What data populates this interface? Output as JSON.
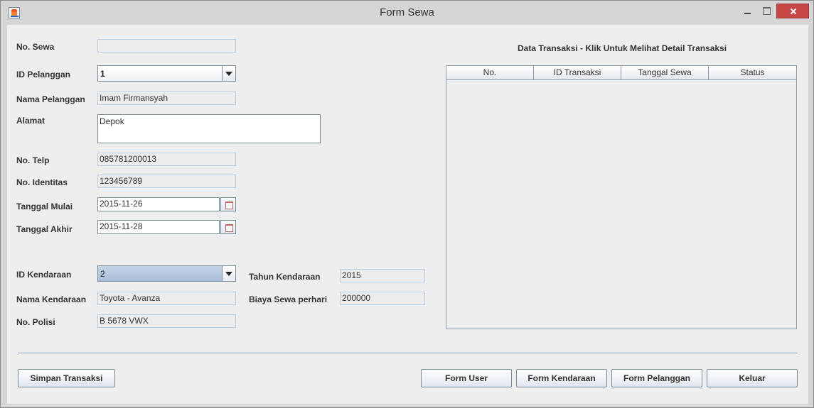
{
  "window": {
    "title": "Form Sewa"
  },
  "form": {
    "no_sewa": {
      "label": "No. Sewa",
      "value": ""
    },
    "id_pelanggan": {
      "label": "ID Pelanggan",
      "value": "1"
    },
    "nama_pelanggan": {
      "label": "Nama Pelanggan",
      "value": "Imam Firmansyah"
    },
    "alamat": {
      "label": "Alamat",
      "value": "Depok"
    },
    "no_telp": {
      "label": "No. Telp",
      "value": "085781200013"
    },
    "no_identitas": {
      "label": "No. Identitas",
      "value": "123456789"
    },
    "tanggal_mulai": {
      "label": "Tanggal Mulai",
      "value": "2015-11-26"
    },
    "tanggal_akhir": {
      "label": "Tanggal Akhir",
      "value": "2015-11-28"
    },
    "id_kendaraan": {
      "label": "ID Kendaraan",
      "value": "2"
    },
    "nama_kendaraan": {
      "label": "Nama Kendaraan",
      "value": "Toyota - Avanza"
    },
    "no_polisi": {
      "label": "No. Polisi",
      "value": "B 5678 VWX"
    },
    "tahun_kendaraan": {
      "label": "Tahun Kendaraan",
      "value": "2015"
    },
    "biaya_sewa": {
      "label": "Biaya Sewa perhari",
      "value": "200000"
    }
  },
  "transactions": {
    "title": "Data Transaksi - Klik Untuk Melihat Detail Transaksi",
    "columns": [
      "No.",
      "ID Transaksi",
      "Tanggal Sewa",
      "Status"
    ],
    "rows": []
  },
  "buttons": {
    "simpan": "Simpan Transaksi",
    "form_user": "Form User",
    "form_kendaraan": "Form Kendaraan",
    "form_pelanggan": "Form Pelanggan",
    "keluar": "Keluar"
  },
  "icons": {
    "app": "java-cup-icon",
    "calendar": "calendar-icon",
    "dropdown": "chevron-down-icon"
  }
}
